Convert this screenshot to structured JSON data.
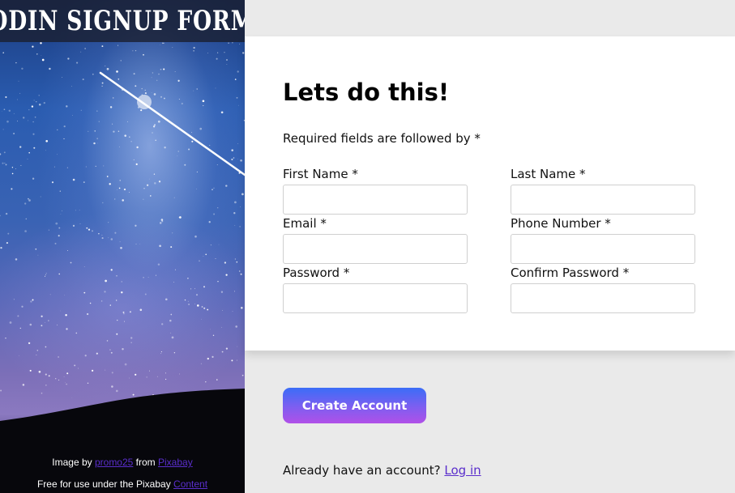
{
  "hero": {
    "title": "ODIN SIGNUP FORM",
    "credit_prefix": "Image by ",
    "credit_author": "promo25",
    "credit_middle": " from ",
    "credit_site": "Pixabay",
    "license_prefix": "Free for use under the Pixabay ",
    "license_link": "Content"
  },
  "form": {
    "heading": "Lets do this!",
    "required_note": "Required fields are followed by *",
    "fields": [
      {
        "label": "First Name *",
        "value": "",
        "placeholder": ""
      },
      {
        "label": "Last Name *",
        "value": "",
        "placeholder": ""
      },
      {
        "label": "Email *",
        "value": "",
        "placeholder": ""
      },
      {
        "label": "Phone Number *",
        "value": "",
        "placeholder": ""
      },
      {
        "label": "Password *",
        "value": "",
        "placeholder": ""
      },
      {
        "label": "Confirm Password *",
        "value": "",
        "placeholder": ""
      }
    ]
  },
  "actions": {
    "create_label": "Create Account",
    "login_prompt": "Already have an account? ",
    "login_link": "Log in"
  },
  "colors": {
    "page_bg": "#eaeaea",
    "card_bg": "#ffffff",
    "button_gradient_start": "#3b6df7",
    "button_gradient_end": "#b150e8",
    "link": "#5a2ecc"
  }
}
